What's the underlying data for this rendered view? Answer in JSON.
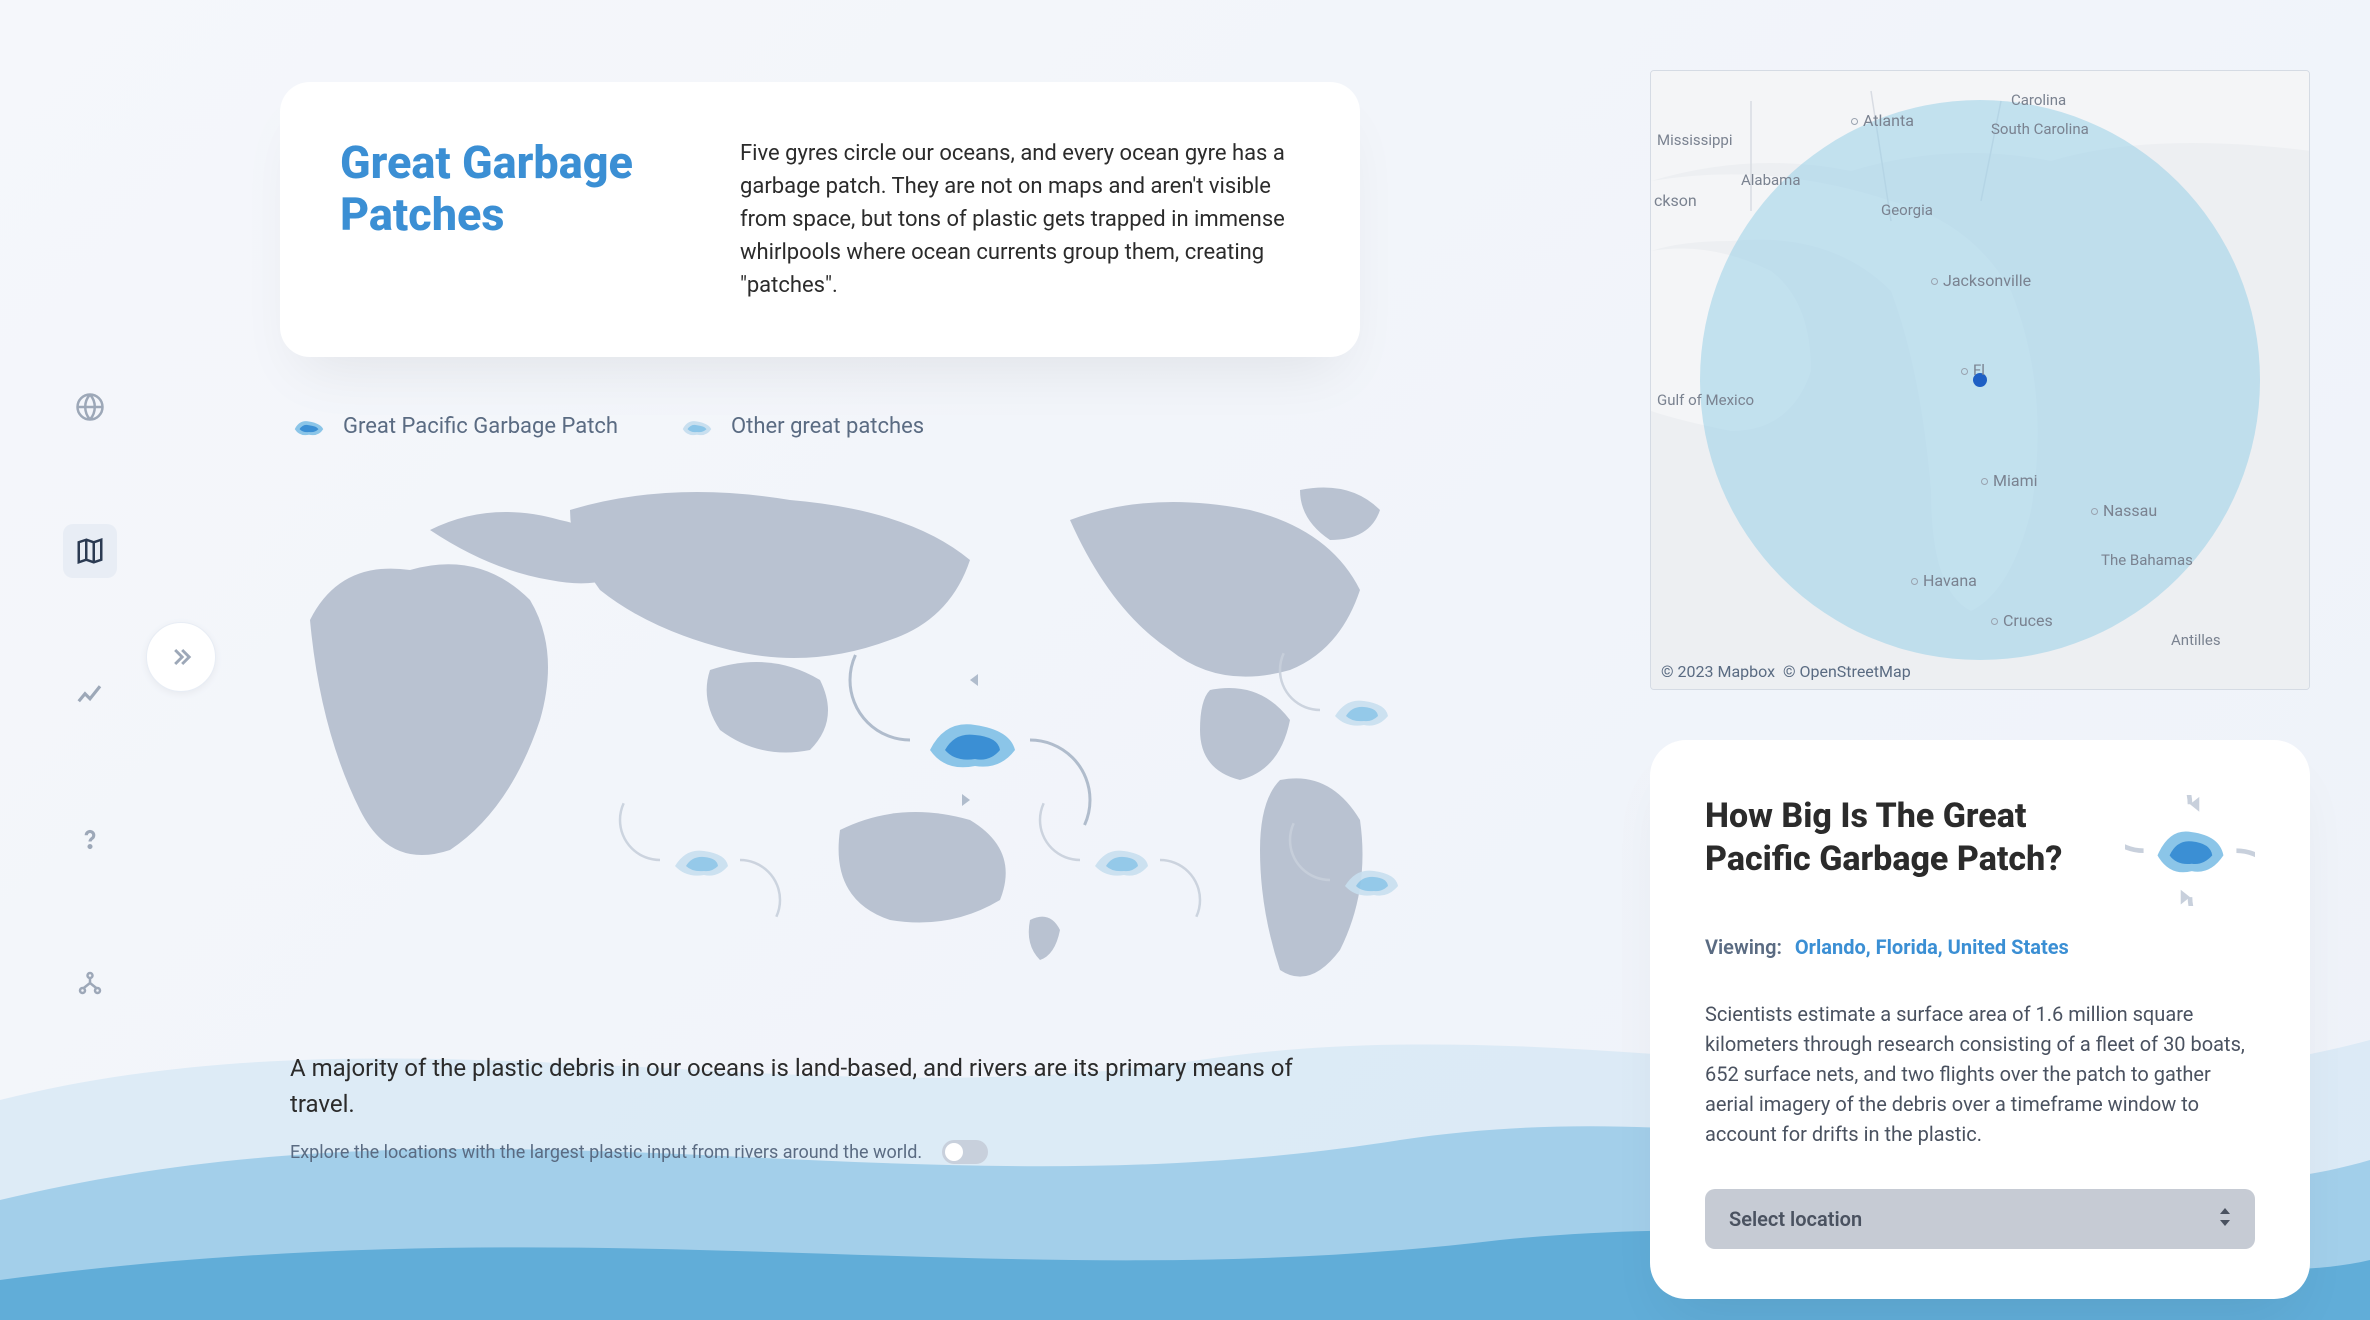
{
  "header": {
    "title": "Great Garbage Patches",
    "description": "Five gyres circle our oceans, and every ocean gyre has a garbage patch. They are not on maps and aren't visible from space, but tons of plastic gets trapped in immense whirlpools where ocean currents group them, creating \"patches\"."
  },
  "legend": {
    "primary": "Great Pacific Garbage Patch",
    "secondary": "Other great patches"
  },
  "footer": {
    "main": "A majority of the plastic debris in our oceans is land-based, and rivers are its primary means of travel.",
    "sub": "Explore the locations with the largest plastic input from rivers around the world."
  },
  "map": {
    "attribution_mapbox": "© 2023 Mapbox",
    "attribution_osm": "© OpenStreetMap",
    "labels": {
      "atlanta": "Atlanta",
      "carolina": "Carolina",
      "south_carolina": "South Carolina",
      "alabama": "Alabama",
      "georgia": "Georgia",
      "jacksonville": "Jacksonville",
      "fl": "Fl",
      "miami": "Miami",
      "nassau": "Nassau",
      "bahamas": "The Bahamas",
      "havana": "Havana",
      "cruces": "Cruces",
      "antilles": "Antilles",
      "gulf": "Gulf of Mexico",
      "mississippi": "Mississippi",
      "jackson": "ckson"
    }
  },
  "info": {
    "title": "How Big Is The Great Pacific Garbage Patch?",
    "viewing_label": "Viewing:",
    "viewing_value": "Orlando, Florida, United States",
    "description": "Scientists estimate a surface area of 1.6 million square kilometers through research consisting of a fleet of 30 boats, 652 surface nets, and two flights over the patch to gather aerial imagery of the debris over a timeframe window to account for drifts in the plastic.",
    "select_label": "Select location"
  },
  "sidebar": {
    "items": [
      "globe",
      "map",
      "chart",
      "help",
      "share"
    ]
  }
}
